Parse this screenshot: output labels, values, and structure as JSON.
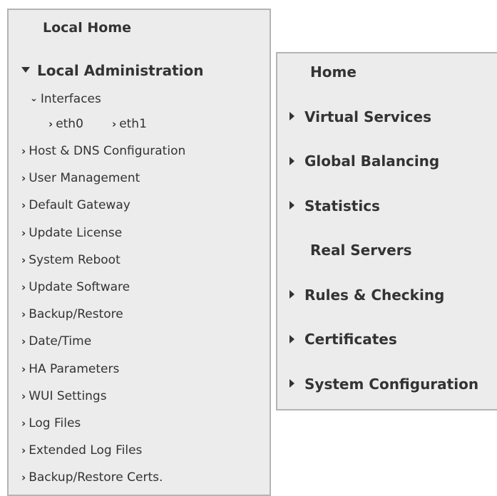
{
  "left_menu": {
    "local_home": "Local Home",
    "local_administration": "Local Administration",
    "interfaces": {
      "label": "Interfaces",
      "children": [
        "eth0",
        "eth1"
      ]
    },
    "items": [
      "Host & DNS Configuration",
      "User Management",
      "Default Gateway",
      "Update License",
      "System Reboot",
      "Update Software",
      "Backup/Restore",
      "Date/Time",
      "HA Parameters",
      "WUI Settings",
      "Log Files",
      "Extended Log Files",
      "Backup/Restore Certs."
    ]
  },
  "right_menu": {
    "items": [
      {
        "label": "Home",
        "expandable": false
      },
      {
        "label": "Virtual Services",
        "expandable": true
      },
      {
        "label": "Global Balancing",
        "expandable": true
      },
      {
        "label": "Statistics",
        "expandable": true
      },
      {
        "label": "Real Servers",
        "expandable": false
      },
      {
        "label": "Rules & Checking",
        "expandable": true
      },
      {
        "label": "Certificates",
        "expandable": true
      },
      {
        "label": "System Configuration",
        "expandable": true
      }
    ]
  },
  "colors": {
    "panel_background": "#ececec",
    "panel_border": "#b4b4b4",
    "text": "#333333"
  }
}
